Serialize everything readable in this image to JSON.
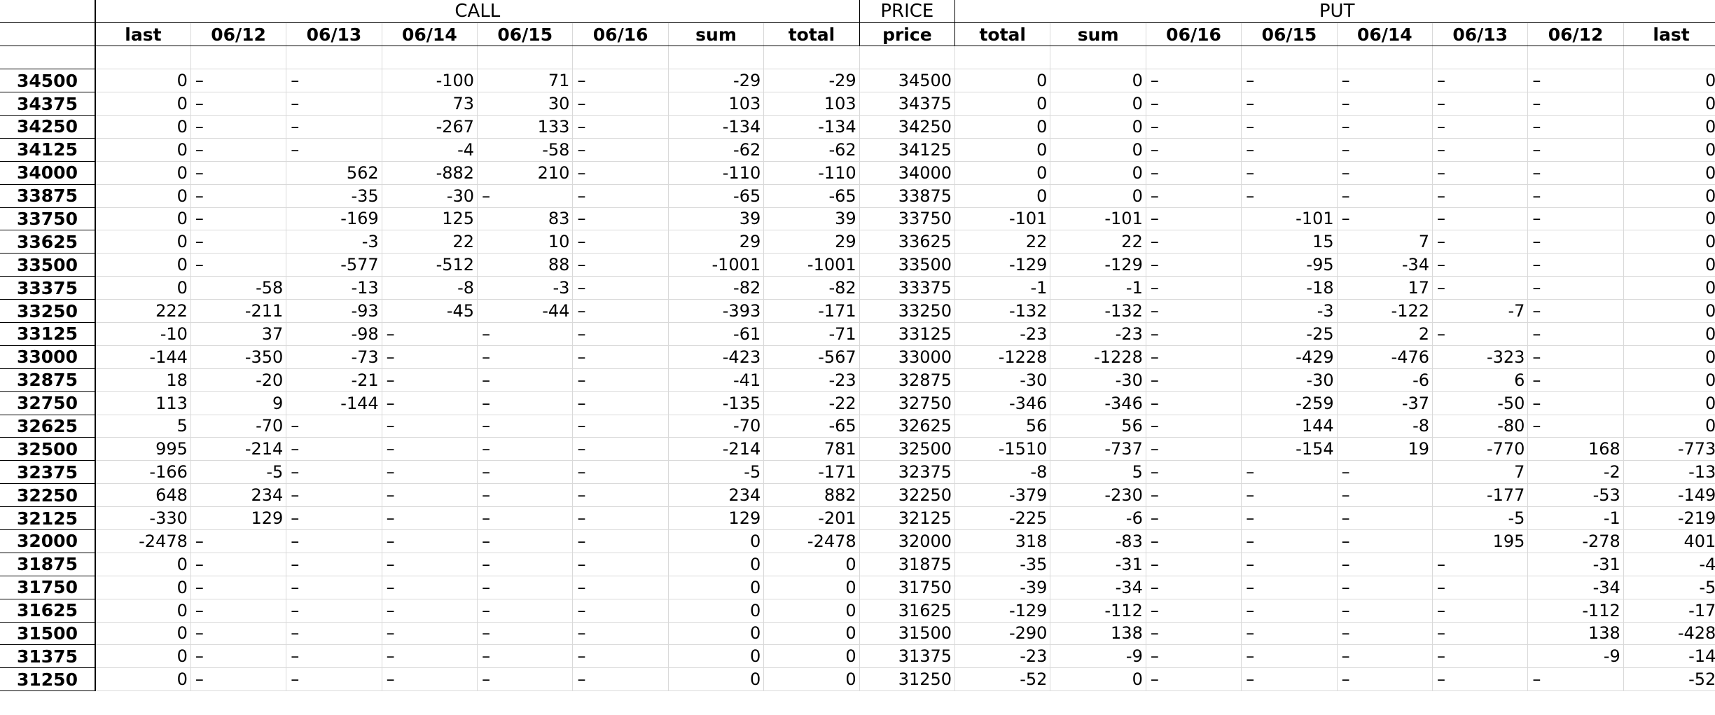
{
  "header": {
    "call_label": "CALL",
    "price_label": "PRICE",
    "put_label": "PUT",
    "call_columns": [
      "last",
      "06/12",
      "06/13",
      "06/14",
      "06/15",
      "06/16",
      "sum",
      "total"
    ],
    "price_column": "price",
    "put_columns": [
      "total",
      "sum",
      "06/16",
      "06/15",
      "06/14",
      "06/13",
      "06/12",
      "last"
    ]
  },
  "rows": [
    {
      "strike": "34500",
      "call": [
        "0",
        "–",
        "–",
        "-100",
        "71",
        "–",
        "-29",
        "-29"
      ],
      "price": "34500",
      "put": [
        "0",
        "0",
        "–",
        "–",
        "–",
        "–",
        "–",
        "0"
      ]
    },
    {
      "strike": "34375",
      "call": [
        "0",
        "–",
        "–",
        "73",
        "30",
        "–",
        "103",
        "103"
      ],
      "price": "34375",
      "put": [
        "0",
        "0",
        "–",
        "–",
        "–",
        "–",
        "–",
        "0"
      ]
    },
    {
      "strike": "34250",
      "call": [
        "0",
        "–",
        "–",
        "-267",
        "133",
        "–",
        "-134",
        "-134"
      ],
      "price": "34250",
      "put": [
        "0",
        "0",
        "–",
        "–",
        "–",
        "–",
        "–",
        "0"
      ]
    },
    {
      "strike": "34125",
      "call": [
        "0",
        "–",
        "–",
        "-4",
        "-58",
        "–",
        "-62",
        "-62"
      ],
      "price": "34125",
      "put": [
        "0",
        "0",
        "–",
        "–",
        "–",
        "–",
        "–",
        "0"
      ]
    },
    {
      "strike": "34000",
      "call": [
        "0",
        "–",
        "562",
        "-882",
        "210",
        "–",
        "-110",
        "-110"
      ],
      "price": "34000",
      "put": [
        "0",
        "0",
        "–",
        "–",
        "–",
        "–",
        "–",
        "0"
      ]
    },
    {
      "strike": "33875",
      "call": [
        "0",
        "–",
        "-35",
        "-30",
        "–",
        "–",
        "-65",
        "-65"
      ],
      "price": "33875",
      "put": [
        "0",
        "0",
        "–",
        "–",
        "–",
        "–",
        "–",
        "0"
      ]
    },
    {
      "strike": "33750",
      "call": [
        "0",
        "–",
        "-169",
        "125",
        "83",
        "–",
        "39",
        "39"
      ],
      "price": "33750",
      "put": [
        "-101",
        "-101",
        "–",
        "-101",
        "–",
        "–",
        "–",
        "0"
      ]
    },
    {
      "strike": "33625",
      "call": [
        "0",
        "–",
        "-3",
        "22",
        "10",
        "–",
        "29",
        "29"
      ],
      "price": "33625",
      "put": [
        "22",
        "22",
        "–",
        "15",
        "7",
        "–",
        "–",
        "0"
      ]
    },
    {
      "strike": "33500",
      "call": [
        "0",
        "–",
        "-577",
        "-512",
        "88",
        "–",
        "-1001",
        "-1001"
      ],
      "price": "33500",
      "put": [
        "-129",
        "-129",
        "–",
        "-95",
        "-34",
        "–",
        "–",
        "0"
      ]
    },
    {
      "strike": "33375",
      "call": [
        "0",
        "-58",
        "-13",
        "-8",
        "-3",
        "–",
        "-82",
        "-82"
      ],
      "price": "33375",
      "put": [
        "-1",
        "-1",
        "–",
        "-18",
        "17",
        "–",
        "–",
        "0"
      ]
    },
    {
      "strike": "33250",
      "call": [
        "222",
        "-211",
        "-93",
        "-45",
        "-44",
        "–",
        "-393",
        "-171"
      ],
      "price": "33250",
      "put": [
        "-132",
        "-132",
        "–",
        "-3",
        "-122",
        "-7",
        "–",
        "0"
      ]
    },
    {
      "strike": "33125",
      "call": [
        "-10",
        "37",
        "-98",
        "–",
        "–",
        "–",
        "-61",
        "-71"
      ],
      "price": "33125",
      "put": [
        "-23",
        "-23",
        "–",
        "-25",
        "2",
        "–",
        "–",
        "0"
      ]
    },
    {
      "strike": "33000",
      "call": [
        "-144",
        "-350",
        "-73",
        "–",
        "–",
        "–",
        "-423",
        "-567"
      ],
      "price": "33000",
      "put": [
        "-1228",
        "-1228",
        "–",
        "-429",
        "-476",
        "-323",
        "–",
        "0"
      ]
    },
    {
      "strike": "32875",
      "call": [
        "18",
        "-20",
        "-21",
        "–",
        "–",
        "–",
        "-41",
        "-23"
      ],
      "price": "32875",
      "put": [
        "-30",
        "-30",
        "–",
        "-30",
        "-6",
        "6",
        "–",
        "0"
      ]
    },
    {
      "strike": "32750",
      "call": [
        "113",
        "9",
        "-144",
        "–",
        "–",
        "–",
        "-135",
        "-22"
      ],
      "price": "32750",
      "put": [
        "-346",
        "-346",
        "–",
        "-259",
        "-37",
        "-50",
        "–",
        "0"
      ]
    },
    {
      "strike": "32625",
      "call": [
        "5",
        "-70",
        "–",
        "–",
        "–",
        "–",
        "-70",
        "-65"
      ],
      "price": "32625",
      "put": [
        "56",
        "56",
        "–",
        "144",
        "-8",
        "-80",
        "–",
        "0"
      ]
    },
    {
      "strike": "32500",
      "call": [
        "995",
        "-214",
        "–",
        "–",
        "–",
        "–",
        "-214",
        "781"
      ],
      "price": "32500",
      "put": [
        "-1510",
        "-737",
        "–",
        "-154",
        "19",
        "-770",
        "168",
        "-773"
      ]
    },
    {
      "strike": "32375",
      "call": [
        "-166",
        "-5",
        "–",
        "–",
        "–",
        "–",
        "-5",
        "-171"
      ],
      "price": "32375",
      "put": [
        "-8",
        "5",
        "–",
        "–",
        "–",
        "7",
        "-2",
        "-13"
      ]
    },
    {
      "strike": "32250",
      "call": [
        "648",
        "234",
        "–",
        "–",
        "–",
        "–",
        "234",
        "882"
      ],
      "price": "32250",
      "put": [
        "-379",
        "-230",
        "–",
        "–",
        "–",
        "-177",
        "-53",
        "-149"
      ]
    },
    {
      "strike": "32125",
      "call": [
        "-330",
        "129",
        "–",
        "–",
        "–",
        "–",
        "129",
        "-201"
      ],
      "price": "32125",
      "put": [
        "-225",
        "-6",
        "–",
        "–",
        "–",
        "-5",
        "-1",
        "-219"
      ]
    },
    {
      "strike": "32000",
      "call": [
        "-2478",
        "–",
        "–",
        "–",
        "–",
        "–",
        "0",
        "-2478"
      ],
      "price": "32000",
      "put": [
        "318",
        "-83",
        "–",
        "–",
        "–",
        "195",
        "-278",
        "401"
      ]
    },
    {
      "strike": "31875",
      "call": [
        "0",
        "–",
        "–",
        "–",
        "–",
        "–",
        "0",
        "0"
      ],
      "price": "31875",
      "put": [
        "-35",
        "-31",
        "–",
        "–",
        "–",
        "–",
        "-31",
        "-4"
      ]
    },
    {
      "strike": "31750",
      "call": [
        "0",
        "–",
        "–",
        "–",
        "–",
        "–",
        "0",
        "0"
      ],
      "price": "31750",
      "put": [
        "-39",
        "-34",
        "–",
        "–",
        "–",
        "–",
        "-34",
        "-5"
      ]
    },
    {
      "strike": "31625",
      "call": [
        "0",
        "–",
        "–",
        "–",
        "–",
        "–",
        "0",
        "0"
      ],
      "price": "31625",
      "put": [
        "-129",
        "-112",
        "–",
        "–",
        "–",
        "–",
        "-112",
        "-17"
      ]
    },
    {
      "strike": "31500",
      "call": [
        "0",
        "–",
        "–",
        "–",
        "–",
        "–",
        "0",
        "0"
      ],
      "price": "31500",
      "put": [
        "-290",
        "138",
        "–",
        "–",
        "–",
        "–",
        "138",
        "-428"
      ]
    },
    {
      "strike": "31375",
      "call": [
        "0",
        "–",
        "–",
        "–",
        "–",
        "–",
        "0",
        "0"
      ],
      "price": "31375",
      "put": [
        "-23",
        "-9",
        "–",
        "–",
        "–",
        "–",
        "-9",
        "-14"
      ]
    },
    {
      "strike": "31250",
      "call": [
        "0",
        "–",
        "–",
        "–",
        "–",
        "–",
        "0",
        "0"
      ],
      "price": "31250",
      "put": [
        "-52",
        "0",
        "–",
        "–",
        "–",
        "–",
        "–",
        "-52"
      ]
    }
  ]
}
